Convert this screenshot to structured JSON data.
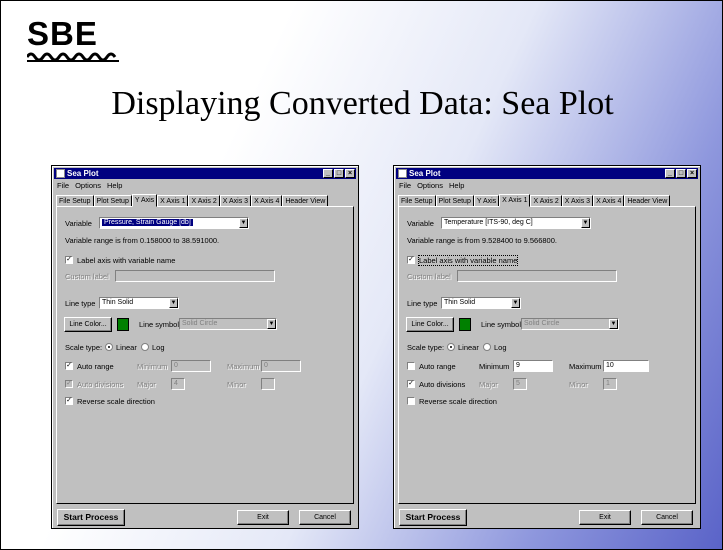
{
  "slide": {
    "logo_text": "SBE",
    "title": "Displaying Converted Data: Sea Plot"
  },
  "windows": [
    {
      "title": "Sea Plot",
      "menu": [
        "File",
        "Options",
        "Help"
      ],
      "tabs": [
        "File Setup",
        "Plot Setup",
        "Y Axis",
        "X Axis 1",
        "X Axis 2",
        "X Axis 3",
        "X Axis 4",
        "Header View"
      ],
      "active_tab": "Y Axis",
      "variable_label": "Variable",
      "variable_value": "Pressure, Strain Gauge [db]",
      "variable_range": "Variable range is from 0.158000 to 38.591000.",
      "label_axis_check": "Label axis with variable name",
      "custom_label": "Custom label",
      "line_type_label": "Line type",
      "line_type_value": "Thin Solid",
      "line_color_button": "Line Color...",
      "line_symbol_label": "Line symbol",
      "line_symbol_value": "Solid Circle",
      "scale_type_label": "Scale type:",
      "scale_linear": "Linear",
      "scale_log": "Log",
      "auto_range": "Auto range",
      "minimum_label": "Minimum",
      "minimum_value": "0",
      "maximum_label": "Maximum",
      "maximum_value": "0",
      "auto_divisions": "Auto divisions",
      "major_label": "Major",
      "major_value": "4",
      "minor_label": "Minor",
      "minor_value": "",
      "reverse_scale": "Reverse scale direction",
      "start_button": "Start Process",
      "exit_button": "Exit",
      "cancel_button": "Cancel",
      "line_color": "#008000"
    },
    {
      "title": "Sea Plot",
      "menu": [
        "File",
        "Options",
        "Help"
      ],
      "tabs": [
        "File Setup",
        "Plot Setup",
        "Y Axis",
        "X Axis 1",
        "X Axis 2",
        "X Axis 3",
        "X Axis 4",
        "Header View"
      ],
      "active_tab": "X Axis 1",
      "variable_label": "Variable",
      "variable_value": "Temperature [ITS-90, deg C]",
      "variable_range": "Variable range is from 9.528400 to 9.566800.",
      "label_axis_check": "Label axis with variable name",
      "custom_label": "Custom label",
      "line_type_label": "Line type",
      "line_type_value": "Thin Solid",
      "line_color_button": "Line Color...",
      "line_symbol_label": "Line symbol",
      "line_symbol_value": "Solid Circle",
      "scale_type_label": "Scale type:",
      "scale_linear": "Linear",
      "scale_log": "Log",
      "auto_range": "Auto range",
      "minimum_label": "Minimum",
      "minimum_value": "9",
      "maximum_label": "Maximum",
      "maximum_value": "10",
      "auto_divisions": "Auto divisions",
      "major_label": "Major",
      "major_value": "5",
      "minor_label": "Minor",
      "minor_value": "1",
      "reverse_scale": "Reverse scale direction",
      "start_button": "Start Process",
      "exit_button": "Exit",
      "cancel_button": "Cancel",
      "line_color": "#008000"
    }
  ]
}
